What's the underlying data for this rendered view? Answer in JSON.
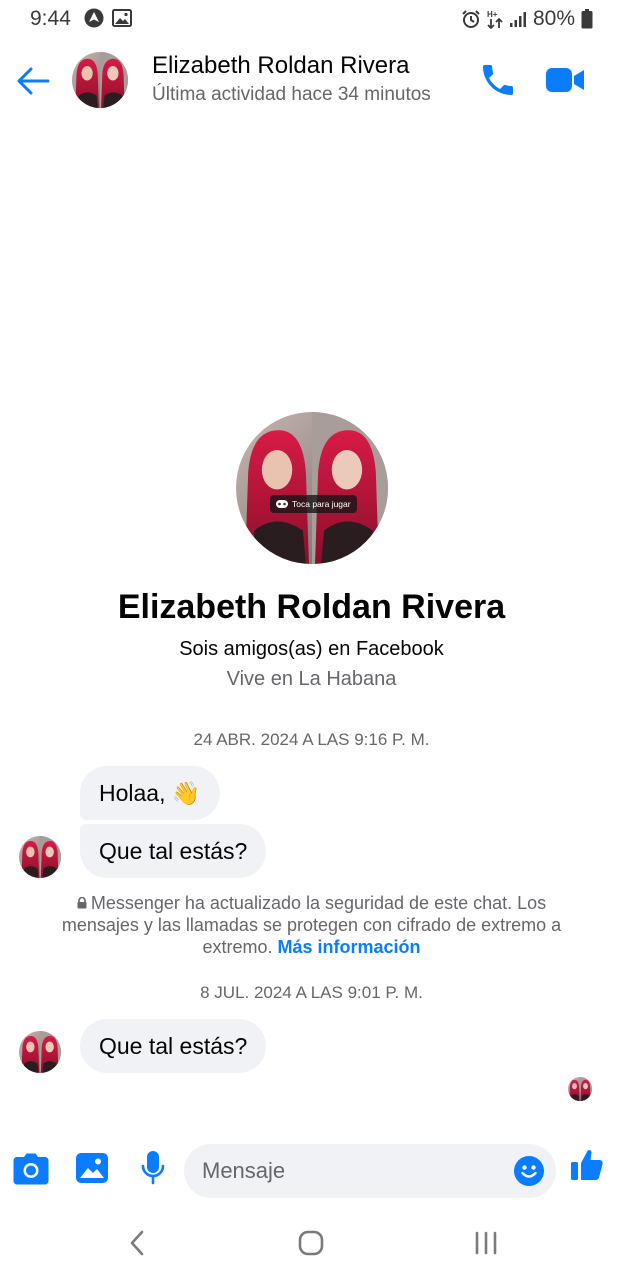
{
  "status_bar": {
    "time": "9:44",
    "battery": "80%",
    "left_icons": [
      "navigation-icon",
      "image-icon"
    ],
    "right_icons": [
      "alarm-icon",
      "data-arrows-icon",
      "signal-icon",
      "battery-icon"
    ]
  },
  "header": {
    "name": "Elizabeth Roldan Rivera",
    "status": "Última actividad hace 34 minutos",
    "accent_color": "#0a7cff"
  },
  "profile": {
    "name": "Elizabeth Roldan Rivera",
    "friends": "Sois amigos(as) en Facebook",
    "location": "Vive en La Habana",
    "avatar_overlay": "Toca para jugar"
  },
  "conversation": {
    "date_1": "24 ABR. 2024 A LAS 9:16 P. M.",
    "message_1": "Holaa, 👋",
    "message_2": "Que tal estás?",
    "security_notice": "Messenger ha actualizado la seguridad de este chat. Los mensajes y las llamadas se protegen con cifrado de extremo a extremo.",
    "security_link": "Más información",
    "date_2": "8 JUL. 2024 A LAS 9:01 P. M.",
    "message_3": "Que tal estás?"
  },
  "composer": {
    "placeholder": "Mensaje",
    "icons": [
      "camera-icon",
      "gallery-icon",
      "microphone-icon",
      "emoji-icon",
      "like-icon"
    ]
  },
  "colors": {
    "bubble": "#f0f2f5",
    "secondary_text": "#65676b",
    "primary_text": "#050505"
  }
}
